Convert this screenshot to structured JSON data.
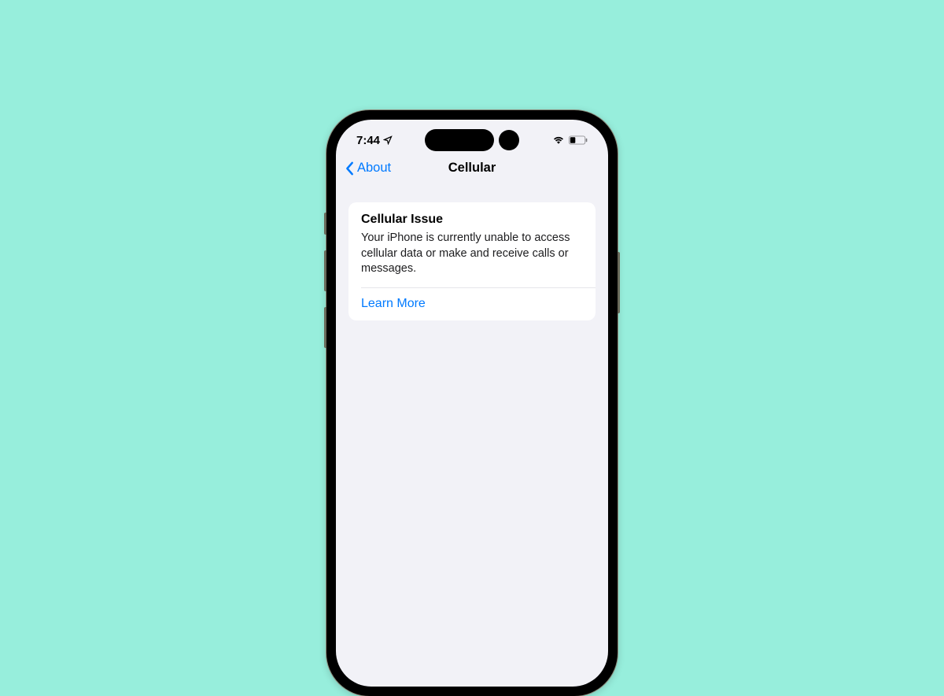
{
  "status_bar": {
    "time": "7:44"
  },
  "nav": {
    "back_label": "About",
    "title": "Cellular"
  },
  "card": {
    "title": "Cellular Issue",
    "body": "Your iPhone is currently unable to access cellular data or make and receive calls or messages.",
    "link_label": "Learn More"
  }
}
